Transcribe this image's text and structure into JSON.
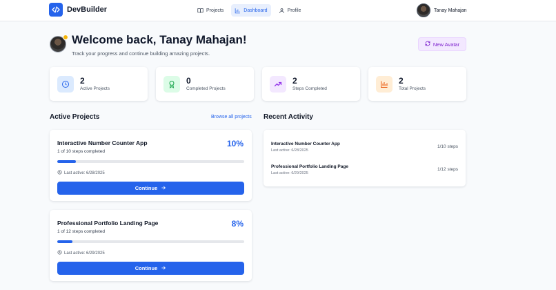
{
  "nav": {
    "brand": "DevBuilder",
    "links": [
      {
        "label": "Projects",
        "icon": "book-icon",
        "active": false
      },
      {
        "label": "Dashboard",
        "icon": "bar-chart-icon",
        "active": true
      },
      {
        "label": "Profile",
        "icon": "user-icon",
        "active": false
      }
    ],
    "user_name": "Tanay Mahajan"
  },
  "welcome": {
    "title": "Welcome back, Tanay Mahajan!",
    "subtitle": "Track your progress and continue building amazing projects.",
    "new_avatar_label": "New Avatar"
  },
  "stats": [
    {
      "value": "2",
      "label": "Active Projects",
      "icon": "clock-icon",
      "color": "#2563eb",
      "bg": "#dbeafe"
    },
    {
      "value": "0",
      "label": "Completed Projects",
      "icon": "award-icon",
      "color": "#16a34a",
      "bg": "#dcfce7"
    },
    {
      "value": "2",
      "label": "Steps Completed",
      "icon": "trending-up-icon",
      "color": "#9333ea",
      "bg": "#f3e8ff"
    },
    {
      "value": "2",
      "label": "Total Projects",
      "icon": "bar-chart-icon",
      "color": "#ea580c",
      "bg": "#ffedd5"
    }
  ],
  "active_projects": {
    "title": "Active Projects",
    "browse_label": "Browse all projects",
    "items": [
      {
        "title": "Interactive Number Counter App",
        "steps": "1 of 10 steps completed",
        "percent_label": "10%",
        "progress": 0.1,
        "last_active": "Last active: 6/28/2025",
        "button": "Continue"
      },
      {
        "title": "Professional Portfolio Landing Page",
        "steps": "1 of 12 steps completed",
        "percent_label": "8%",
        "progress": 0.08,
        "last_active": "Last active: 6/29/2025",
        "button": "Continue"
      }
    ]
  },
  "recent_activity": {
    "title": "Recent Activity",
    "items": [
      {
        "title": "Interactive Number Counter App",
        "date": "Last active: 6/28/2025",
        "steps": "1/10 steps"
      },
      {
        "title": "Professional Portfolio Landing Page",
        "date": "Last active: 6/29/2025",
        "steps": "1/12 steps"
      }
    ]
  },
  "colors": {
    "accent": "#2563eb",
    "background": "#f8fafc",
    "avatar_button": "#f3e8ff"
  }
}
